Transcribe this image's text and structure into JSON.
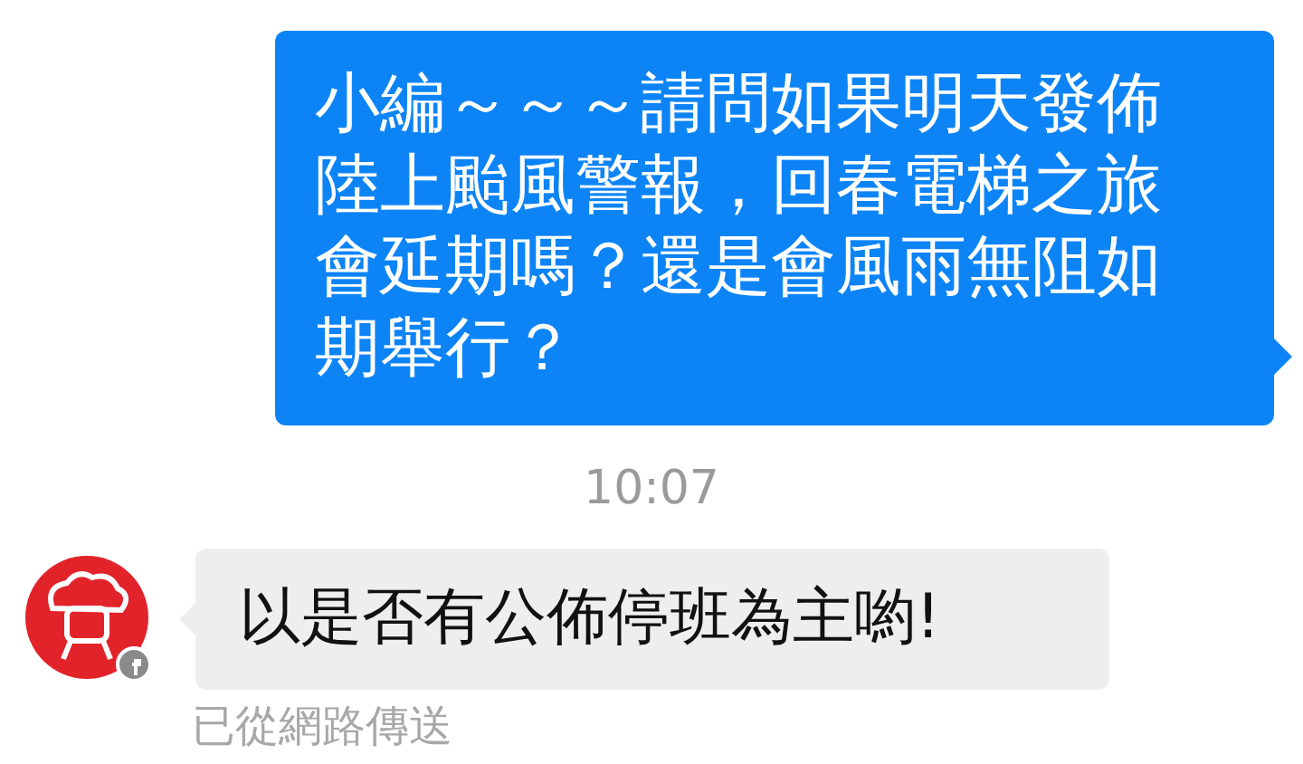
{
  "messages": [
    {
      "kind": "sent",
      "text": "小編～～～請問如果明天發佈陸上颱風警報，回春電梯之旅會延期嗎？還是會風雨無阻如期舉行？"
    },
    {
      "kind": "timestamp",
      "text": "10:07"
    },
    {
      "kind": "received",
      "text": "以是否有公佈停班為主喲!",
      "note": "已從網路傳送"
    }
  ]
}
